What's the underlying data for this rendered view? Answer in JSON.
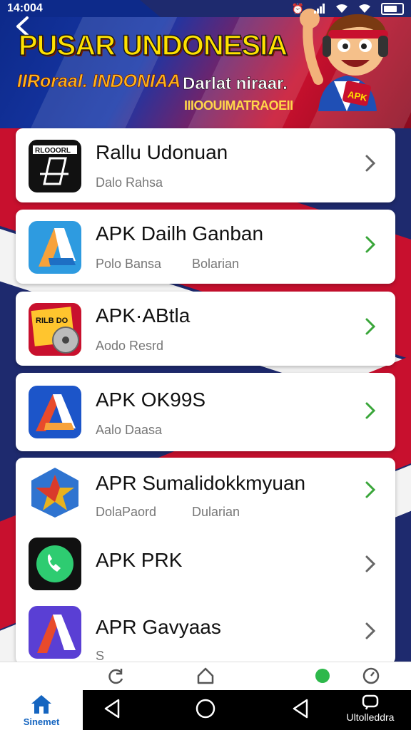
{
  "status_bar": {
    "time": "14:004"
  },
  "banner": {
    "title": "PUSAR UNDONESIA",
    "subtitle_left": "IIRoraal. INDONIAA",
    "subtitle_right": "Darlat niraar.",
    "subtitle_small": "IIIOOUIMATRAOEII",
    "mascot_badge": "APK"
  },
  "apps": [
    {
      "name": "Rallu Udonuan",
      "sub": "Dalo Rahsa",
      "sub2": "",
      "chevron_color": "#666666"
    },
    {
      "name": "APK Dailh Ganban",
      "sub": "Polo Bansa",
      "sub2": "Bolarian",
      "chevron_color": "#3aa63a"
    },
    {
      "name": "APK·ABtla",
      "sub": "Aodo Resrd",
      "sub2": "",
      "chevron_color": "#3aa63a"
    },
    {
      "name": "APK OK99S",
      "sub": "Aalo Daasa",
      "sub2": "",
      "chevron_color": "#3aa63a"
    },
    {
      "name": "APR Sumalidokkmyuan",
      "sub": "DolaPaord",
      "sub2": "Dularian",
      "chevron_color": "#3aa63a"
    },
    {
      "name": "APK PRK",
      "sub": "",
      "sub2": "",
      "chevron_color": "#666666"
    },
    {
      "name": "APR Gavyaas",
      "sub": "S",
      "sub2": "",
      "chevron_color": "#666666"
    }
  ],
  "app_icons": {
    "0": {
      "label": "RLOOORL"
    },
    "2": {
      "label": "RILB DO"
    }
  },
  "bottom_nav": {
    "home_label": "Sinemet",
    "right_label": "Ultolleddra"
  },
  "icons": [
    "back-arrow-icon",
    "signal-icon",
    "wifi-icon",
    "battery-icon",
    "chevron-right-icon",
    "home-icon",
    "refresh-icon",
    "house-outline-icon",
    "status-dot-icon",
    "gauge-icon",
    "back-triangle-icon",
    "circle-home-icon",
    "recents-icon"
  ],
  "colors": {
    "accent_green": "#3aa63a",
    "brand_red": "#c8102e",
    "brand_blue": "#0d2a8a",
    "banner_yellow": "#ffe100"
  }
}
